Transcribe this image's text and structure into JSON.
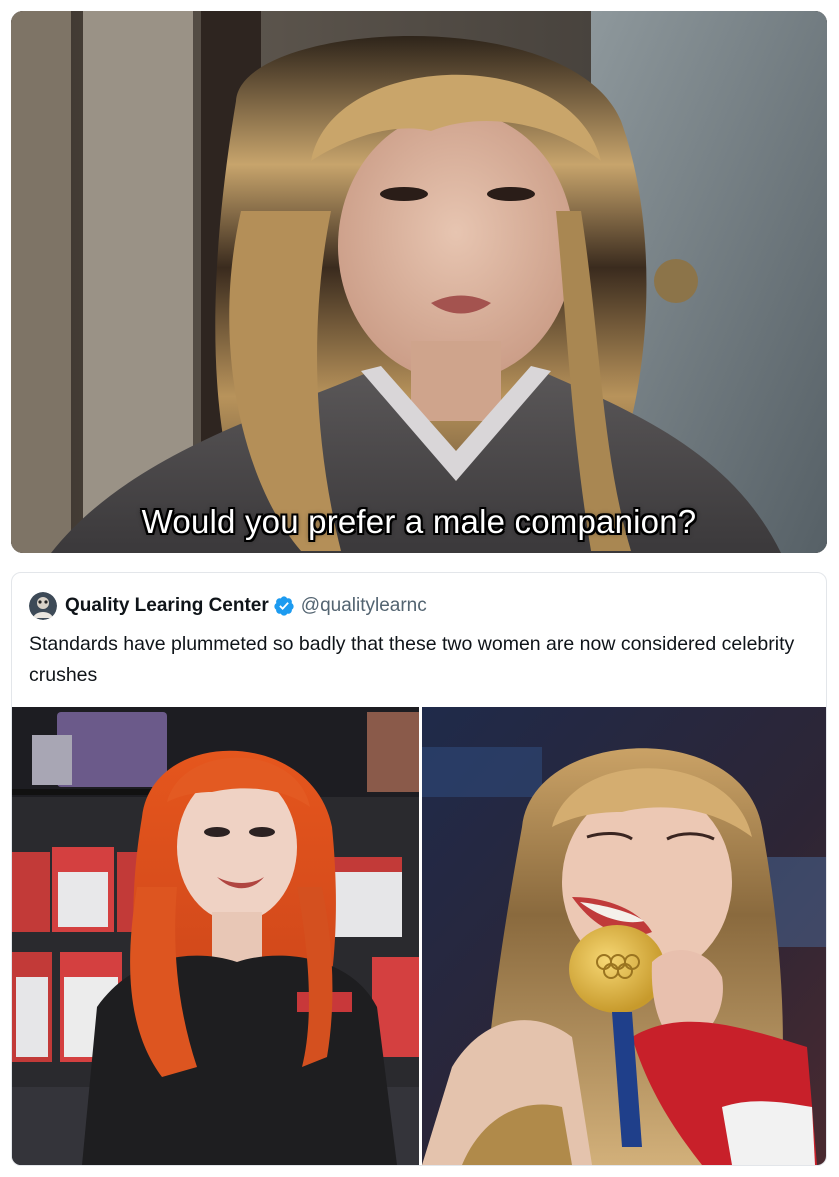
{
  "movie_still": {
    "subtitle": "Would you prefer a male companion?"
  },
  "tweet": {
    "display_name": "Quality Learing Center",
    "verified": true,
    "handle": "@qualitylearnc",
    "text": "Standards have plummeted so badly that these two women are now considered celebrity crushes",
    "media": [
      {
        "alt": "Woman with orange hair in a store"
      },
      {
        "alt": "Woman biting a gold medal"
      }
    ]
  },
  "colors": {
    "verified_badge": "#1d9bf0",
    "handle_gray": "#536471",
    "text_black": "#0f1419"
  },
  "icons": {
    "verified": "verified-badge-icon",
    "avatar": "user-avatar"
  }
}
